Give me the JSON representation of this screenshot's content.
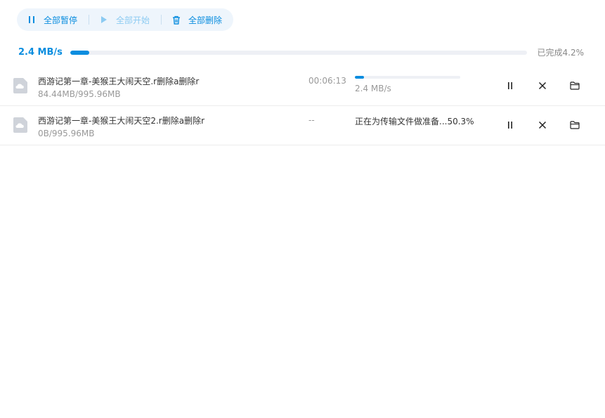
{
  "toolbar": {
    "pause_all_label": "全部暂停",
    "start_all_label": "全部开始",
    "delete_all_label": "全部删除"
  },
  "overall": {
    "speed": "2.4 MB/s",
    "progress_fraction": 0.042,
    "done_text": "已完成4.2%"
  },
  "downloads": [
    {
      "name": "西游记第一章-美猴王大闹天空.r删除a删除r",
      "size": "84.44MB/995.96MB",
      "time": "00:06:13",
      "progress_fraction": 0.085,
      "speed": "2.4 MB/s",
      "status": ""
    },
    {
      "name": "西游记第一章-美猴王大闹天空2.r删除a删除r",
      "size": "0B/995.96MB",
      "time": "--",
      "progress_fraction": 0,
      "speed": "",
      "status": "正在为传输文件做准备...50.3%"
    }
  ],
  "colors": {
    "accent": "#0a8ddf",
    "accent_light": "#8ccbf2",
    "toolbar_bg": "#eef5fc",
    "track": "#eef0f5"
  },
  "icons": {
    "toolbar": [
      "pause-icon",
      "play-icon",
      "trash-icon"
    ],
    "row_actions": [
      "pause-icon",
      "close-icon",
      "folder-icon"
    ],
    "file": "cloud-file-icon"
  }
}
